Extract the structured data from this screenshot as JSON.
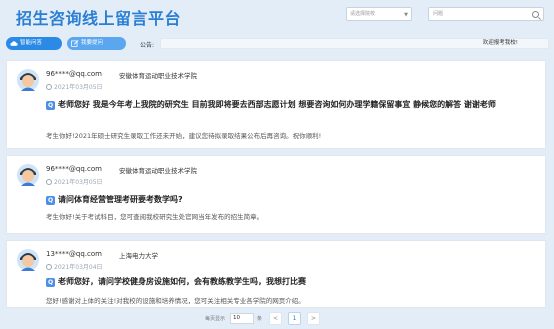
{
  "header": {
    "title": "招生咨询线上留言平台",
    "school_select_placeholder": "请选择院校",
    "search_placeholder": "问题"
  },
  "toolbar": {
    "smart_reply_label": "智能问答",
    "ask_label": "我要提问",
    "notice_label": "公告:",
    "notice_text": "欢迎报考我校!"
  },
  "messages": [
    {
      "user": "96****@qq.com",
      "school": "安徽体育运动职业技术学院",
      "date": "2021年03月05日",
      "question": "老师您好 我是今年考上我院的研究生 目前我即将要去西部志愿计划 想要咨询如何办理学籍保留事宜 静候您的解答 谢谢老师",
      "answer": "考生你好!2021年硕士研究生录取工作还未开始，建议您待拟录取结果公布后再咨询。祝你顺利!"
    },
    {
      "user": "96****@qq.com",
      "school": "安徽体育运动职业技术学院",
      "date": "2021年03月05日",
      "question": "请问体育经营管理考研要考数学吗?",
      "answer": "考生你好!关于考试科目，您可查阅我校研究生处官网当年发布的招生简章。"
    },
    {
      "user": "13****@qq.com",
      "school": "上海电力大学",
      "date": "2021年03月04日",
      "question": "老师您好，请问学校健身房设施如何，会有教练教学生吗，我想打比赛",
      "answer": "您好!感谢对上体的关注!对我校的设施和培养情况，您可关注相关专业各学院的网页介绍。"
    }
  ],
  "pager": {
    "label": "每页显示",
    "page_size": "10",
    "unit": "条",
    "prev": "<",
    "current": "1",
    "next": ">"
  },
  "colors": {
    "accent": "#2a7fd4",
    "background": "#e3edf8",
    "question_icon": "#4e8fe6"
  },
  "icons": {
    "question": "Q",
    "smart_reply": "cloud-icon",
    "ask": "edit-icon"
  }
}
